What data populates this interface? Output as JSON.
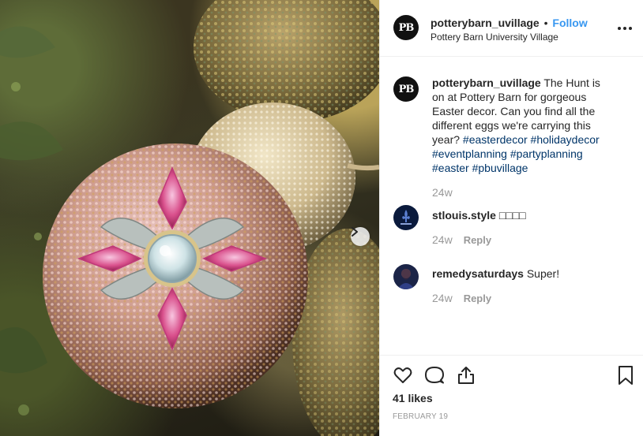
{
  "post": {
    "photo_alt": "Beaded pink Easter egg ornament",
    "next_icon": "chevron-right-icon"
  },
  "header": {
    "avatar_initials": "PB",
    "username": "potterybarn_uvillage",
    "separator": "•",
    "follow_label": "Follow",
    "location": "Pottery Barn University Village",
    "more_icon": "more-options-icon"
  },
  "caption": {
    "avatar_initials": "PB",
    "username": "potterybarn_uvillage",
    "text": "The Hunt is on at Pottery Barn for gorgeous Easter decor. Can you find all the different eggs we're carrying this year?",
    "hashtags": [
      "#easterdecor",
      "#holidaydecor",
      "#eventplanning",
      "#partyplanning",
      "#easter",
      "#pbuvillage"
    ],
    "time": "24w"
  },
  "comments": [
    {
      "username": "stlouis.style",
      "text": "□□□□",
      "time": "24w",
      "reply_label": "Reply"
    },
    {
      "username": "remedysaturdays",
      "text": "Super!",
      "time": "24w",
      "reply_label": "Reply"
    }
  ],
  "actions": {
    "like_icon": "heart-icon",
    "comment_icon": "comment-icon",
    "share_icon": "share-icon",
    "save_icon": "bookmark-icon",
    "likes": "41 likes",
    "date": "FEBRUARY 19"
  },
  "colors": {
    "link": "#3897f0",
    "hashtag": "#003569",
    "muted": "#999999",
    "text": "#262626"
  }
}
